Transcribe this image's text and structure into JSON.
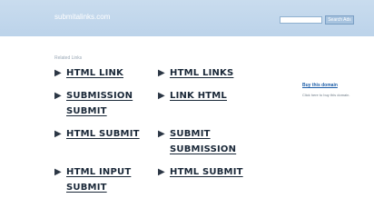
{
  "header": {
    "site_title": "submitalinks.com",
    "search": {
      "placeholder": "",
      "button_label": "Search Ads"
    }
  },
  "main": {
    "related_label": "Related Links",
    "links": [
      {
        "label": "HTML LINK",
        "arrow": "play-arrow-icon"
      },
      {
        "label": "HTML LINKS",
        "arrow": "play-arrow-icon"
      },
      {
        "label": "SUBMISSION SUBMIT",
        "arrow": "play-arrow-icon"
      },
      {
        "label": "LINK HTML",
        "arrow": "play-arrow-icon"
      },
      {
        "label": "HTML SUBMIT",
        "arrow": "play-arrow-icon"
      },
      {
        "label": "SUBMIT SUBMISSION",
        "arrow": "play-arrow-icon"
      },
      {
        "label": "HTML INPUT SUBMIT",
        "arrow": "play-arrow-icon"
      },
      {
        "label": "HTML SUBMIT",
        "arrow": "play-arrow-icon"
      }
    ]
  },
  "sidebar": {
    "buy_link": "Buy this domain",
    "buy_text": "Click here to buy this domain."
  },
  "colors": {
    "header": "#c2d7ec",
    "link_text": "#1a2838",
    "side_link": "#1d5ea8"
  }
}
